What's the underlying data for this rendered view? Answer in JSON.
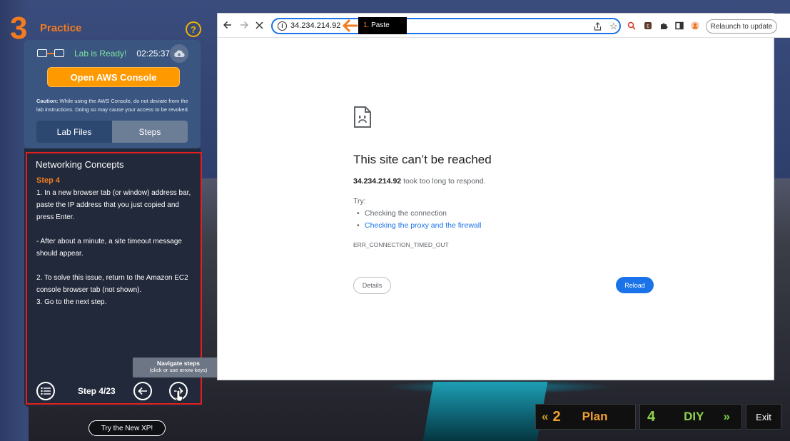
{
  "practice": {
    "number": "3",
    "label": "Practice",
    "help_symbol": "?"
  },
  "lab": {
    "status": "Lab is Ready!",
    "timer": "02:25:37",
    "open_console_label": "Open AWS Console",
    "caution_bold": "Caution:",
    "caution_text": " While using the AWS Console, do not deviate from the lab instructions. Doing so may cause your access to be revoked."
  },
  "tabs": {
    "lab_files": "Lab Files",
    "steps": "Steps",
    "active": "Steps"
  },
  "steps": {
    "section_title": "Networking Concepts",
    "step_label": "Step 4",
    "lines": [
      "1. In a new browser tab (or window) address bar, paste the IP address that you just copied and press Enter.",
      "",
      "- After about a minute, a site timeout message should appear.",
      "",
      "2. To solve this issue, return to the Amazon EC2 console browser tab (not shown).",
      "3. Go to the next step."
    ],
    "counter": "Step 4/23",
    "tooltip_title": "Navigate steps",
    "tooltip_subtitle": "(click or use arrow keys)"
  },
  "try_xp_label": "Try the New XP!",
  "browser": {
    "url": "34.234.214.92",
    "annotation_number": "1.",
    "annotation_text": " Paste",
    "relaunch_label": "Relaunch to update",
    "error": {
      "title": "This site can’t be reached",
      "host": "34.234.214.92",
      "message": " took too long to respond.",
      "try_label": "Try:",
      "suggestions": [
        "Checking the connection",
        "Checking the proxy and the firewall"
      ],
      "code": "ERR_CONNECTION_TIMED_OUT",
      "details_label": "Details",
      "reload_label": "Reload"
    }
  },
  "nav": {
    "plan_number": "2",
    "plan_label": "Plan",
    "diy_number": "4",
    "diy_label": "DIY",
    "exit_label": "Exit"
  },
  "colors": {
    "accent_orange": "#f47c20",
    "aws_button": "#ff9900",
    "link_blue": "#1a73e8",
    "highlight_red": "#e41f1f",
    "ready_green": "#7fe39e"
  }
}
